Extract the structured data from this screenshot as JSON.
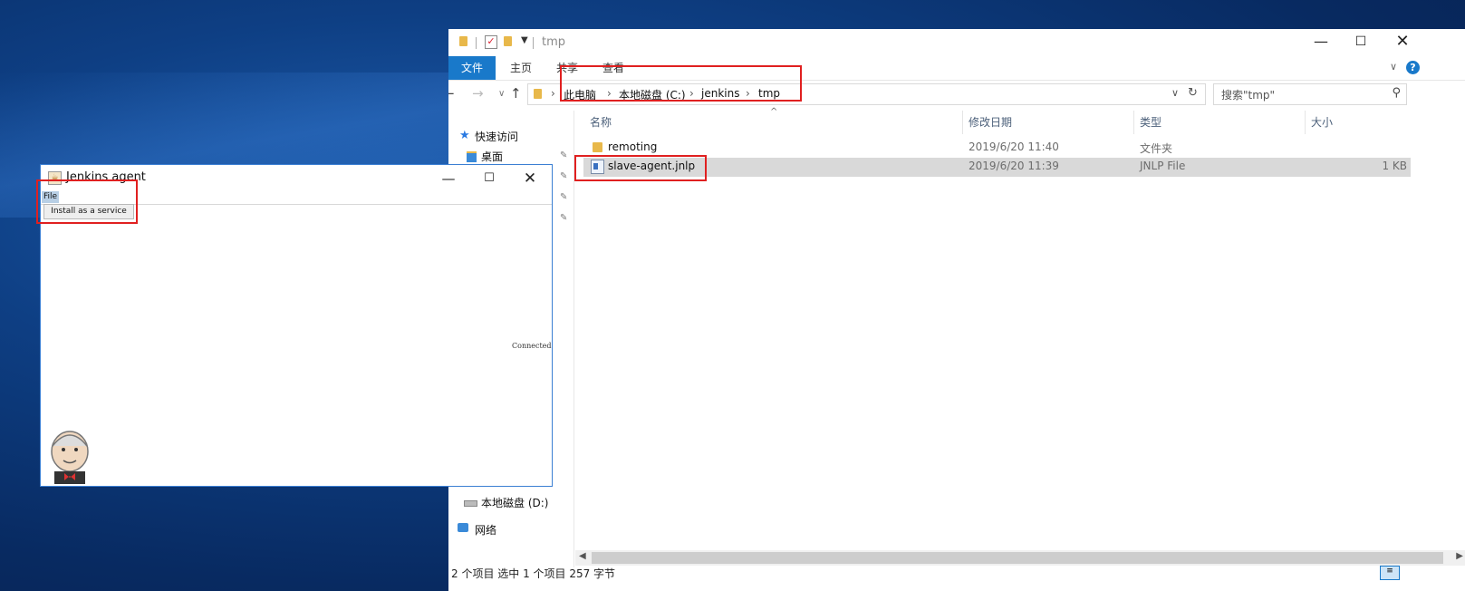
{
  "explorer": {
    "title": "tmp",
    "ribbon_tabs": {
      "file": "文件",
      "home": "主页",
      "share": "共享",
      "view": "查看"
    },
    "address": {
      "crumbs": [
        "此电脑",
        "本地磁盘 (C:)",
        "jenkins",
        "tmp"
      ]
    },
    "search_placeholder": "搜索\"tmp\"",
    "nav": {
      "quick_access": "快速访问",
      "desktop": "桌面",
      "drive_d": "本地磁盘 (D:)",
      "network": "网络"
    },
    "columns": {
      "name": "名称",
      "modified": "修改日期",
      "type": "类型",
      "size": "大小"
    },
    "files": [
      {
        "name": "remoting",
        "modified": "2019/6/20 11:40",
        "type": "文件夹",
        "size": "",
        "icon": "folder-icon"
      },
      {
        "name": "slave-agent.jnlp",
        "modified": "2019/6/20 11:39",
        "type": "JNLP File",
        "size": "1 KB",
        "icon": "jnlp-file-icon"
      }
    ],
    "status": "2 个项目    选中 1 个项目  257 字节"
  },
  "jenkins": {
    "title": "Jenkins agent",
    "menu_file": "File",
    "install_button": "Install as a service",
    "status": "Connected"
  },
  "colors": {
    "accent": "#1979ca",
    "highlight": "#e02020",
    "selection": "#d9d9d9"
  }
}
